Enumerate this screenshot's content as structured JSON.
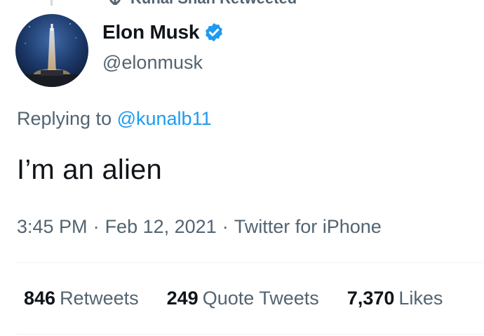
{
  "context": {
    "retweet_text": "Kunal Shah Retweeted"
  },
  "author": {
    "display_name": "Elon Musk",
    "handle": "@elonmusk",
    "verified": true
  },
  "reply": {
    "prefix": "Replying to ",
    "mention": "@kunalb11"
  },
  "tweet": {
    "text": "I’m an alien"
  },
  "meta": {
    "time": "3:45 PM",
    "separator": "·",
    "date": "Feb 12, 2021",
    "source": "Twitter for iPhone"
  },
  "stats": {
    "retweets_count": "846",
    "retweets_label": "Retweets",
    "quotes_count": "249",
    "quotes_label": "Quote Tweets",
    "likes_count": "7,370",
    "likes_label": "Likes"
  },
  "colors": {
    "link_blue": "#1d9bf0",
    "text_primary": "#0f1419",
    "text_secondary": "#536471",
    "divider": "#eff3f4"
  },
  "icons": {
    "retweet": "retweet-icon",
    "verified": "verified-badge-icon",
    "avatar": "rocket-launch-avatar"
  }
}
